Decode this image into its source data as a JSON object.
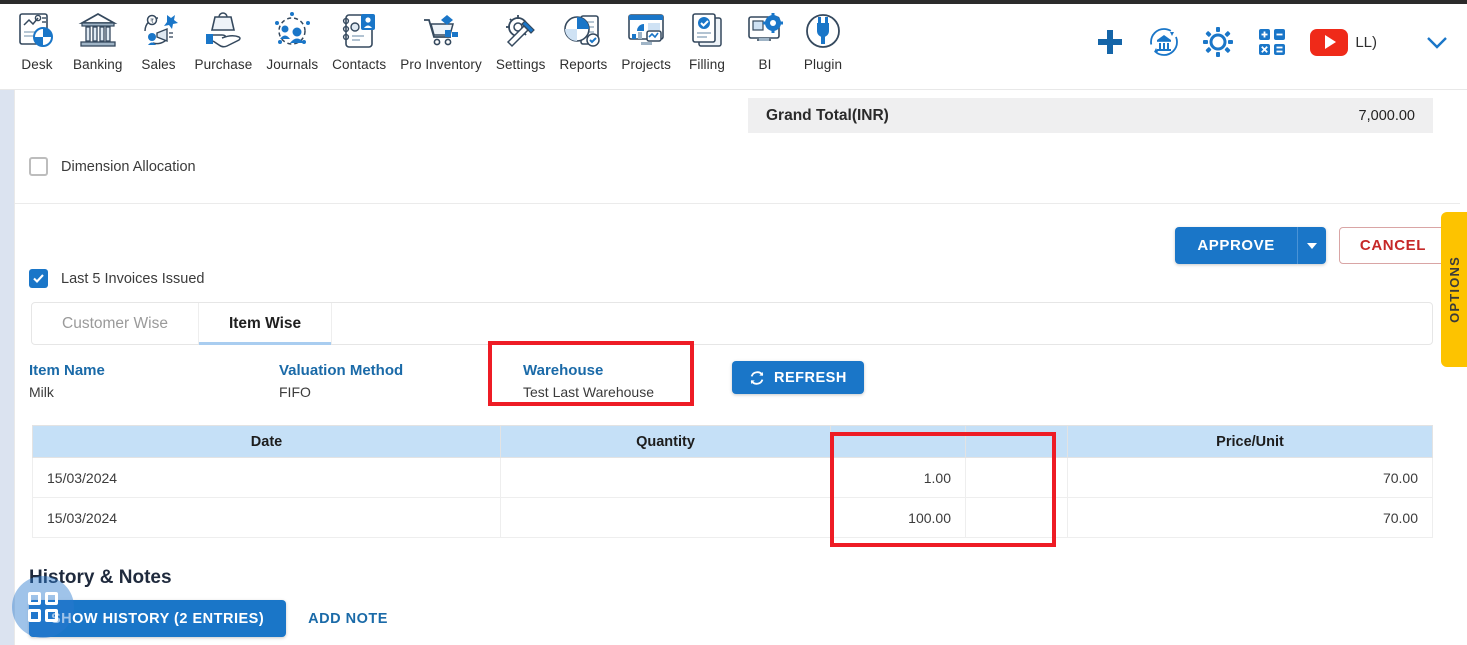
{
  "topbar": {
    "nav_items": [
      {
        "label": "Desk",
        "icon": "desk-dashboard-icon"
      },
      {
        "label": "Banking",
        "icon": "bank-building-icon"
      },
      {
        "label": "Sales",
        "icon": "sales-megaphone-icon"
      },
      {
        "label": "Purchase",
        "icon": "purchase-hand-bag-icon"
      },
      {
        "label": "Journals",
        "icon": "journals-people-gear-icon"
      },
      {
        "label": "Contacts",
        "icon": "contacts-notebook-icon"
      },
      {
        "label": "Pro Inventory",
        "icon": "inventory-cart-icon"
      },
      {
        "label": "Settings",
        "icon": "settings-gear-wrench-icon"
      },
      {
        "label": "Reports",
        "icon": "reports-piechart-icon"
      },
      {
        "label": "Projects",
        "icon": "projects-dashboard-icon"
      },
      {
        "label": "Filling",
        "icon": "filling-documents-icon"
      },
      {
        "label": "BI",
        "icon": "bi-monitor-gear-icon"
      },
      {
        "label": "Plugin",
        "icon": "plugin-plug-icon"
      }
    ],
    "right_icons": [
      {
        "name": "add-plus-icon",
        "title": "Add"
      },
      {
        "name": "bank-refresh-icon",
        "title": "Bank Sync"
      },
      {
        "name": "settings-gear-icon",
        "title": "Settings"
      },
      {
        "name": "calculator-icon",
        "title": "Calculator"
      }
    ],
    "youtube": {
      "icon": "youtube-icon",
      "label": "LL)"
    },
    "chevron": "chevron-down-icon"
  },
  "summary": {
    "grand_total_label": "Grand Total(INR)",
    "grand_total_value": "7,000.00"
  },
  "dimension_allocation": {
    "label": "Dimension Allocation",
    "checked": false
  },
  "actions": {
    "approve_label": "APPROVE",
    "approve_caret": "chevron-down-icon",
    "cancel_label": "CANCEL"
  },
  "last_invoices": {
    "label": "Last 5 Invoices Issued",
    "checked": true
  },
  "tabs": [
    {
      "label": "Customer Wise",
      "active": false
    },
    {
      "label": "Item Wise",
      "active": true
    }
  ],
  "detail_fields": [
    {
      "label": "Item Name",
      "value": "Milk"
    },
    {
      "label": "Valuation Method",
      "value": "FIFO"
    },
    {
      "label": "Warehouse",
      "value": "Test Last Warehouse"
    }
  ],
  "refresh_button": {
    "label": "REFRESH",
    "icon": "refresh-icon"
  },
  "table": {
    "columns": [
      "Date",
      "Quantity",
      "",
      "",
      "Price/Unit"
    ],
    "rows": [
      {
        "date": "15/03/2024",
        "quantity_blank": "",
        "quantity": "1.00",
        "spacer": "",
        "price_unit": "70.00"
      },
      {
        "date": "15/03/2024",
        "quantity_blank": "",
        "quantity": "100.00",
        "spacer": "",
        "price_unit": "70.00"
      }
    ]
  },
  "history": {
    "title": "History & Notes",
    "show_history_label": "SHOW HISTORY (2 ENTRIES)",
    "add_note_label": "ADD NOTE"
  },
  "options_tab": {
    "label": "OPTIONS"
  },
  "accessibility_widget": {
    "name": "accessibility-grid-icon"
  },
  "colors": {
    "primary_blue": "#1a76c8",
    "link_blue": "#1a6aa8",
    "table_header": "#c5e0f7",
    "annotation_red": "#ee1c25",
    "options_yellow": "#fdc300",
    "youtube_red": "#ef2a19",
    "cancel_red": "#c62828"
  }
}
